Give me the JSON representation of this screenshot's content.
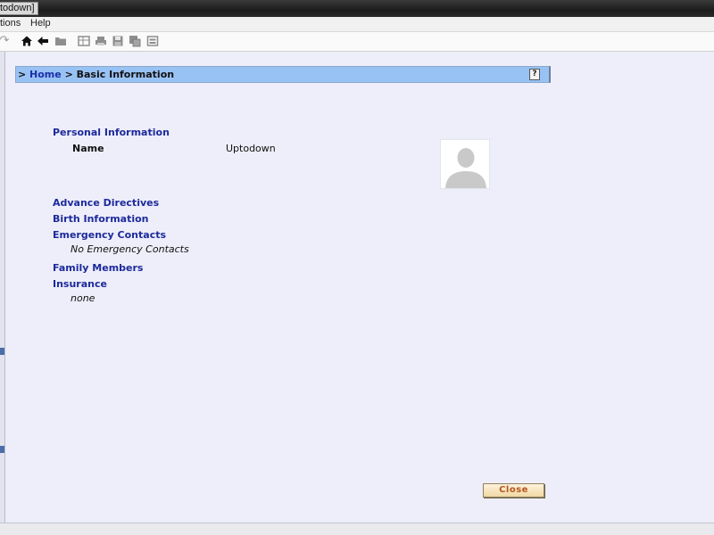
{
  "window": {
    "title_fragment": "todown]"
  },
  "menu": {
    "items": [
      "tions",
      "Help"
    ]
  },
  "toolbar": {
    "icons": [
      "refresh-icon",
      "home-icon",
      "back-arrow-icon",
      "folder-icon",
      "grid-icon",
      "print-icon",
      "save-icon",
      "save-as-icon",
      "export-icon"
    ]
  },
  "breadcrumb": {
    "prefix": "> ",
    "home": "Home",
    "separator": " > ",
    "current": "Basic Information",
    "help": "?"
  },
  "personal": {
    "heading": "Personal Information",
    "name_label": "Name",
    "name_value": "Uptodown"
  },
  "sections": {
    "advance_directives": "Advance Directives",
    "birth_information": "Birth Information",
    "emergency_contacts": "Emergency Contacts",
    "emergency_contacts_value": "No Emergency Contacts",
    "family_members": "Family Members",
    "insurance": "Insurance",
    "insurance_value": "none"
  },
  "actions": {
    "close": "Close"
  }
}
